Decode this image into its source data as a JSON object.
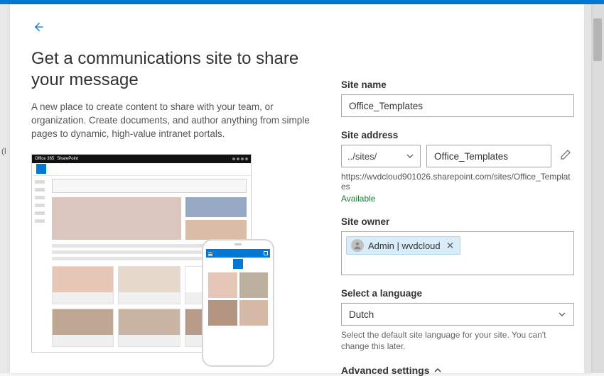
{
  "preview": {
    "o365": "Office 365",
    "sp": "SharePoint"
  },
  "page": {
    "title": "Get a communications site to share your message",
    "description": "A new place to create content to share with your team, or organization. Create documents, and author anything from simple pages to dynamic, high-value intranet portals.",
    "bg_letter": "(l"
  },
  "site_name": {
    "label": "Site name",
    "value": "Office_Templates"
  },
  "site_address": {
    "label": "Site address",
    "prefix": "../sites/",
    "value": "Office_Templates",
    "full_url": "https://wvdcloud901026.sharepoint.com/sites/Office_Templates",
    "availability": "Available"
  },
  "site_owner": {
    "label": "Site owner",
    "display": "Admin | wvdcloud"
  },
  "language": {
    "label": "Select a language",
    "value": "Dutch",
    "hint": "Select the default site language for your site. You can't change this later."
  },
  "advanced": {
    "label": "Advanced settings"
  }
}
